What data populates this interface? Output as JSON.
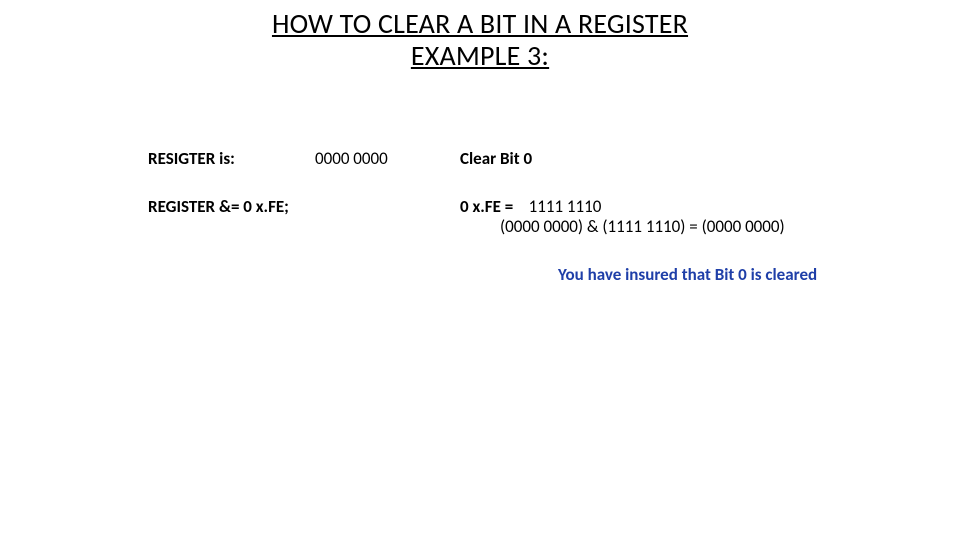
{
  "title": {
    "line1": "HOW TO CLEAR A BIT IN A REGISTER",
    "line2": "EXAMPLE 3:"
  },
  "row1": {
    "label": "RESIGTER is:",
    "value": "0000 0000",
    "action": "Clear Bit 0"
  },
  "row2": {
    "statement": "REGISTER &= 0 x.FE;",
    "mask_label": "0 x.FE =",
    "mask_value": "1111 1110",
    "calc": "(0000 0000)   & (1111 1110) = (0000 0000)"
  },
  "note": "You have insured that Bit 0 is cleared"
}
